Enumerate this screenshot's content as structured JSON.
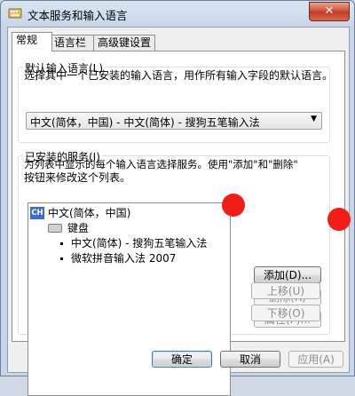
{
  "window": {
    "title": "文本服务和输入语言",
    "close_glyph": "✕"
  },
  "tabs": [
    {
      "label": "常规",
      "active": true
    },
    {
      "label": "语言栏",
      "active": false
    },
    {
      "label": "高级键设置",
      "active": false
    }
  ],
  "default_language": {
    "title": "默认输入语言(L)",
    "description": "选择其中一个已安装的输入语言，用作所有输入字段的默认语言。",
    "selected": "中文(简体，中国) - 中文(简体) - 搜狗五笔输入法"
  },
  "installed_services": {
    "title": "已安装的服务(I)",
    "description_lines": [
      "为列表中显示的每个输入语言选择服务。使用\"添加\"和\"删除\"",
      "按钮来修改这个列表。"
    ],
    "tree": {
      "language_icon_text": "CH",
      "language": "中文(简体，中国)",
      "category": "键盘",
      "items": [
        "中文(简体) - 搜狗五笔输入法",
        "微软拼音输入法 2007"
      ]
    },
    "buttons": {
      "add": "添加(D)...",
      "remove": "删除(R)",
      "properties": "属性(P)...",
      "move_up": "上移(U)",
      "move_down": "下移(O)"
    }
  },
  "footer": {
    "ok": "确定",
    "cancel": "取消",
    "apply": "应用(A)"
  }
}
